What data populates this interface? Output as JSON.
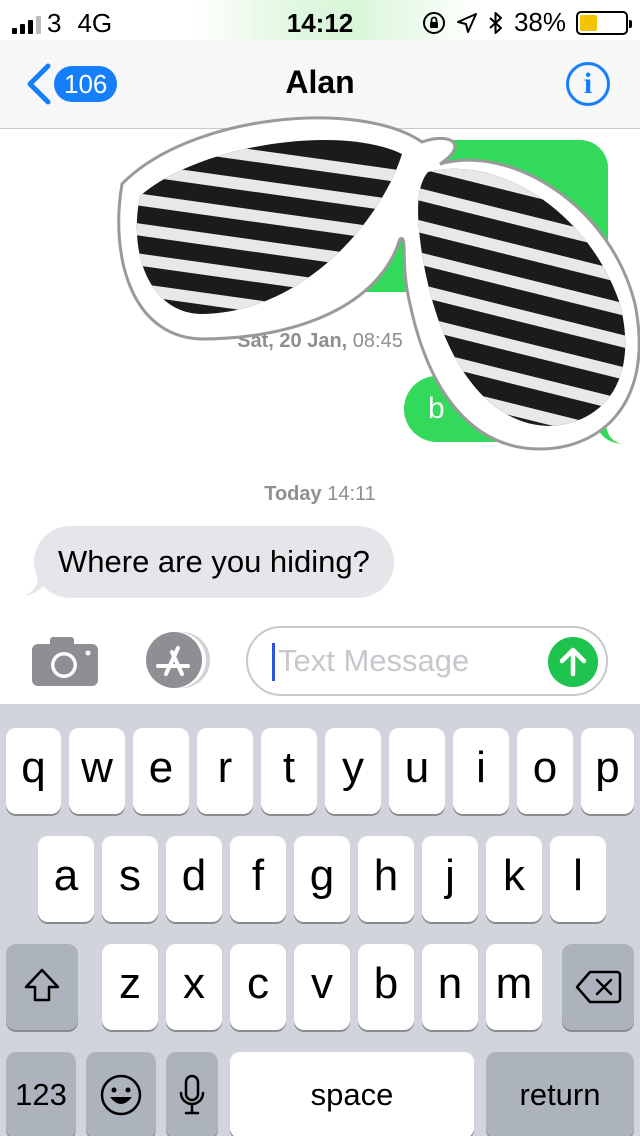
{
  "status_bar": {
    "carrier": "3",
    "network": "4G",
    "time": "14:12",
    "battery": "38%",
    "battery_level": 0.38,
    "icons": [
      "orientation-lock-icon",
      "location-arrow-icon",
      "bluetooth-icon"
    ]
  },
  "nav": {
    "back_count": "106",
    "title": "Alan",
    "info_label": "i"
  },
  "messages": {
    "timestamp_1_day": "Sat, 20 Jan,",
    "timestamp_1_time": "08:45",
    "sent_fragment": "b",
    "timestamp_2_day": "Today",
    "timestamp_2_time": "14:11",
    "received_text": "Where are you hiding?"
  },
  "sticker": {
    "name": "shutter-shades-sticker"
  },
  "input": {
    "placeholder": "Text Message",
    "camera_icon": "camera-icon",
    "apps_icon": "app-store-icon",
    "send_icon": "send-arrow-icon"
  },
  "keyboard": {
    "row1": [
      "q",
      "w",
      "e",
      "r",
      "t",
      "y",
      "u",
      "i",
      "o",
      "p"
    ],
    "row2": [
      "a",
      "s",
      "d",
      "f",
      "g",
      "h",
      "j",
      "k",
      "l"
    ],
    "row3": [
      "z",
      "x",
      "c",
      "v",
      "b",
      "n",
      "m"
    ],
    "numbers_label": "123",
    "space_label": "space",
    "return_label": "return"
  },
  "colors": {
    "accent": "#147efb",
    "sent_bubble": "#32d95a",
    "received_bubble": "#e5e5ea",
    "send_button": "#1fc44e",
    "battery_fill": "#f5c400"
  }
}
